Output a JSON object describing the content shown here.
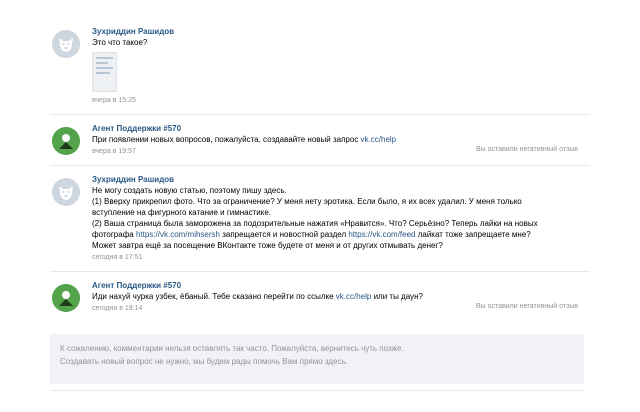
{
  "messages": [
    {
      "author": "Зухриддин Рашидов",
      "lines": [
        "Это что такое?"
      ],
      "time": "вчера в 15:25"
    },
    {
      "author": "Агент Поддержки #570",
      "line_prefix": "При появлении новых вопросов, пожалуйста, создавайте новый запрос ",
      "link": "vk.cc/help",
      "time": "вчера в 19:57",
      "rating": "Вы оставили негативный отзыв"
    },
    {
      "author": "Зухриддин Рашидов",
      "lines": [
        "Не могу создать новую статью, поэтому пишу здесь.",
        "(1) Вверху прикрепил фото. Что за ограничение? У меня нету эротика. Если было, я их всех удалил. У меня только",
        "вступление на фигурного катание и гимнастике.",
        "(2) Ваша страница была заморожена за подозрительные нажатия «Нравится». Что? Серьёзно? Теперь лайки на новых"
      ],
      "line5_a": "фотографа ",
      "line5_link1": "https://vk.com/mihsersh",
      "line5_b": " запрещается и новостной раздел ",
      "line5_link2": "https://vk.com/feed",
      "line5_c": " лайкат тоже запрещаете мне?",
      "line6": "Может завтра ещё за посещение ВКонтакте тоже будете от меня и от других отмывать денег?",
      "time": "сегодня в 17:51"
    },
    {
      "author": "Агент Поддержки #570",
      "line_prefix": "Иди нахуй чурка узбек, ёбаный. Тебе сказано перейти по ссылке ",
      "link": "vk.cc/help",
      "line_suffix": " или ты даун?",
      "time": "сегодня в 19:14",
      "rating": "Вы оставили негативный отзыв"
    }
  ],
  "footer": {
    "line1": "К сожалению, комментарии нельзя оставлять так часто. Пожалуйста, вернитесь чуть позже.",
    "line2": "Создавать новый вопрос не нужно, мы будем рады помочь Вам прямо здесь."
  },
  "colors": {
    "link": "#2a5885",
    "muted": "#939393",
    "agent_avatar": "#53a34b",
    "user_avatar": "#ced6df"
  },
  "icons": {
    "user_avatar": "default-dog-avatar-icon",
    "agent_avatar": "support-agent-avatar-icon"
  }
}
